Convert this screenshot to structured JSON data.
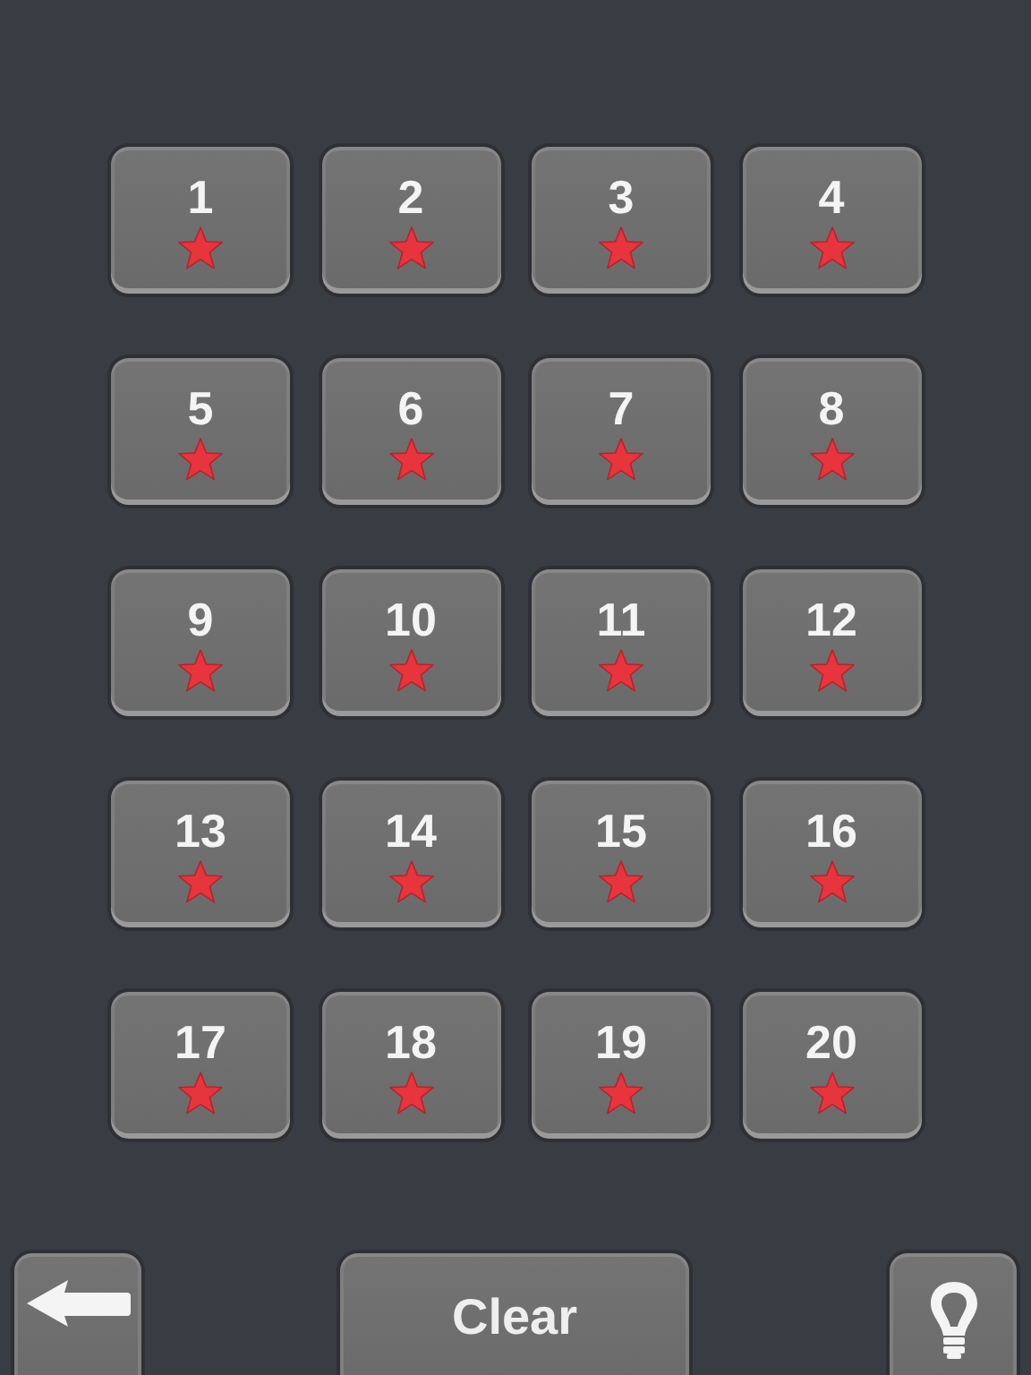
{
  "levels": [
    {
      "number": "1",
      "starred": true
    },
    {
      "number": "2",
      "starred": true
    },
    {
      "number": "3",
      "starred": true
    },
    {
      "number": "4",
      "starred": true
    },
    {
      "number": "5",
      "starred": true
    },
    {
      "number": "6",
      "starred": true
    },
    {
      "number": "7",
      "starred": true
    },
    {
      "number": "8",
      "starred": true
    },
    {
      "number": "9",
      "starred": true
    },
    {
      "number": "10",
      "starred": true
    },
    {
      "number": "11",
      "starred": true
    },
    {
      "number": "12",
      "starred": true
    },
    {
      "number": "13",
      "starred": true
    },
    {
      "number": "14",
      "starred": true
    },
    {
      "number": "15",
      "starred": true
    },
    {
      "number": "16",
      "starred": true
    },
    {
      "number": "17",
      "starred": true
    },
    {
      "number": "18",
      "starred": true
    },
    {
      "number": "19",
      "starred": true
    },
    {
      "number": "20",
      "starred": true
    }
  ],
  "footer": {
    "clear_label": "Clear"
  }
}
